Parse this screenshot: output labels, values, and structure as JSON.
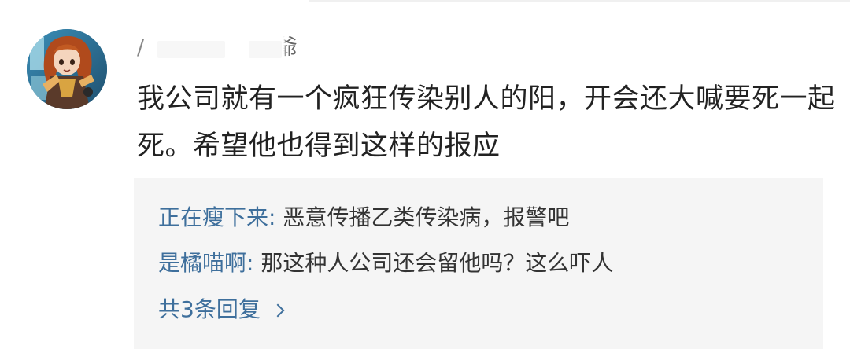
{
  "comment": {
    "username_suffix": "爺",
    "text": "我公司就有一个疯狂传染别人的阳，开会还大喊要死一起死。希望他也得到这样的报应"
  },
  "replies": [
    {
      "author": "正在瘦下来",
      "text": "恶意传播乙类传染病，报警吧"
    },
    {
      "author": "是橘喵啊",
      "text": "那这种人公司还会留他吗？这么吓人"
    }
  ],
  "more_replies": "共3条回复",
  "icons": {
    "avatar": "anime-avatar",
    "more_chevron": "chevron-right-icon"
  },
  "colors": {
    "link": "#3e6f9c",
    "text": "#222222",
    "reply_bg": "#f5f5f5"
  }
}
